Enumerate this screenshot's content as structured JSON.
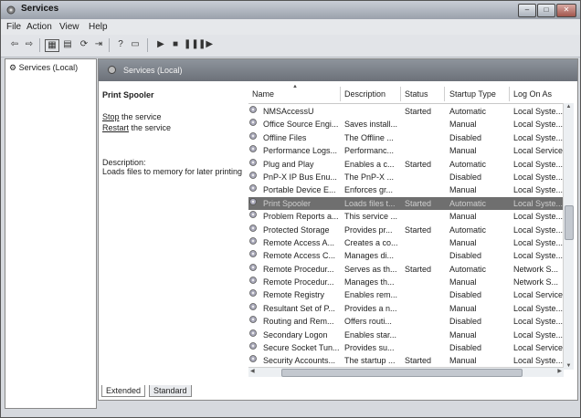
{
  "window": {
    "title": "Services"
  },
  "menu": [
    "File",
    "Action",
    "View",
    "Help"
  ],
  "tree": {
    "root": "Services (Local)"
  },
  "panel": {
    "header": "Services (Local)",
    "selected_service": "Print Spooler",
    "stop_label": "the service",
    "stop_link": "Stop",
    "restart_label": "the service",
    "restart_link": "Restart",
    "description_label": "Description:",
    "description_text": "Loads files to memory for later printing"
  },
  "columns": [
    "Name",
    "Description",
    "Status",
    "Startup Type",
    "Log On As"
  ],
  "services": [
    {
      "name": "NMSAccessU",
      "desc": "",
      "status": "Started",
      "startup": "Automatic",
      "logon": "Local Syste..."
    },
    {
      "name": "Office Source Engi...",
      "desc": "Saves install...",
      "status": "",
      "startup": "Manual",
      "logon": "Local Syste..."
    },
    {
      "name": "Offline Files",
      "desc": "The Offline ...",
      "status": "",
      "startup": "Disabled",
      "logon": "Local Syste..."
    },
    {
      "name": "Performance Logs...",
      "desc": "Performanc...",
      "status": "",
      "startup": "Manual",
      "logon": "Local Service"
    },
    {
      "name": "Plug and Play",
      "desc": "Enables a c...",
      "status": "Started",
      "startup": "Automatic",
      "logon": "Local Syste..."
    },
    {
      "name": "PnP-X IP Bus Enu...",
      "desc": "The PnP-X ...",
      "status": "",
      "startup": "Disabled",
      "logon": "Local Syste..."
    },
    {
      "name": "Portable Device E...",
      "desc": "Enforces gr...",
      "status": "",
      "startup": "Manual",
      "logon": "Local Syste..."
    },
    {
      "name": "Print Spooler",
      "desc": "Loads files t...",
      "status": "Started",
      "startup": "Automatic",
      "logon": "Local Syste...",
      "selected": true
    },
    {
      "name": "Problem Reports a...",
      "desc": "This service ...",
      "status": "",
      "startup": "Manual",
      "logon": "Local Syste..."
    },
    {
      "name": "Protected Storage",
      "desc": "Provides pr...",
      "status": "Started",
      "startup": "Automatic",
      "logon": "Local Syste..."
    },
    {
      "name": "Remote Access A...",
      "desc": "Creates a co...",
      "status": "",
      "startup": "Manual",
      "logon": "Local Syste..."
    },
    {
      "name": "Remote Access C...",
      "desc": "Manages di...",
      "status": "",
      "startup": "Disabled",
      "logon": "Local Syste..."
    },
    {
      "name": "Remote Procedur...",
      "desc": "Serves as th...",
      "status": "Started",
      "startup": "Automatic",
      "logon": "Network S..."
    },
    {
      "name": "Remote Procedur...",
      "desc": "Manages th...",
      "status": "",
      "startup": "Manual",
      "logon": "Network S..."
    },
    {
      "name": "Remote Registry",
      "desc": "Enables rem...",
      "status": "",
      "startup": "Disabled",
      "logon": "Local Service"
    },
    {
      "name": "Resultant Set of P...",
      "desc": "Provides a n...",
      "status": "",
      "startup": "Manual",
      "logon": "Local Syste..."
    },
    {
      "name": "Routing and Rem...",
      "desc": "Offers routi...",
      "status": "",
      "startup": "Disabled",
      "logon": "Local Syste..."
    },
    {
      "name": "Secondary Logon",
      "desc": "Enables star...",
      "status": "",
      "startup": "Manual",
      "logon": "Local Syste..."
    },
    {
      "name": "Secure Socket Tun...",
      "desc": "Provides su...",
      "status": "",
      "startup": "Disabled",
      "logon": "Local Service"
    },
    {
      "name": "Security Accounts...",
      "desc": "The startup ...",
      "status": "Started",
      "startup": "Manual",
      "logon": "Local Syste..."
    }
  ],
  "tabs": [
    "Extended",
    "Standard"
  ]
}
